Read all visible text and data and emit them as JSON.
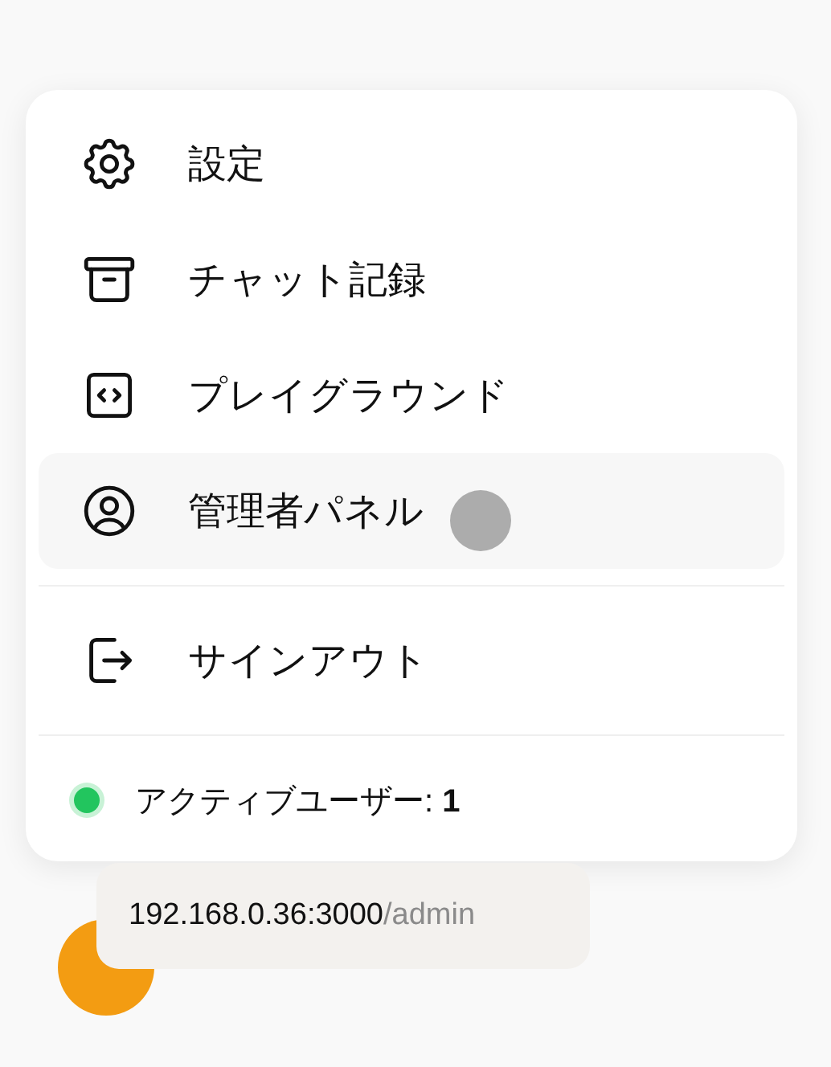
{
  "menu": {
    "items": [
      {
        "label": "設定",
        "selected": false
      },
      {
        "label": "チャット記録",
        "selected": false
      },
      {
        "label": "プレイグラウンド",
        "selected": false
      },
      {
        "label": "管理者パネル",
        "selected": true
      }
    ],
    "footer_items": [
      {
        "label": "サインアウト",
        "selected": false
      }
    ],
    "active_users": {
      "text": "アクティブユーザー: **1**",
      "online": true
    }
  },
  "link_tooltip": {
    "host": "192.168.0.36:3000",
    "path": "/admin"
  }
}
